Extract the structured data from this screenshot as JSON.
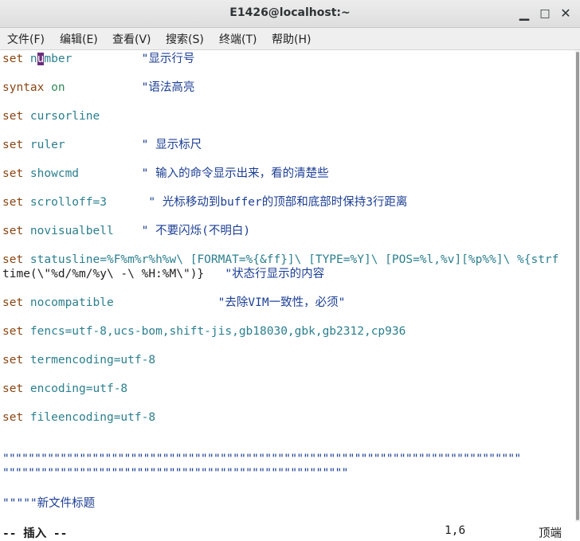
{
  "window": {
    "title": "E1426@localhost:~"
  },
  "menu": [
    "文件(F)",
    "编辑(E)",
    "查看(V)",
    "搜索(S)",
    "终端(T)",
    "帮助(H)"
  ],
  "editor": {
    "lines": [
      {
        "kw": "set",
        "pre": " n",
        "cursor": "u",
        "opt": "mber",
        "pad": "          ",
        "cmt": "\"显示行号"
      },
      {
        "kw": "syntax",
        "on": " on",
        "pad": "           ",
        "cmt": "\"语法高亮"
      },
      {
        "kw": "set",
        "opt": " cursorline"
      },
      {
        "kw": "set",
        "opt": " ruler",
        "pad": "           ",
        "cmt": "\" 显示标尺"
      },
      {
        "kw": "set",
        "opt": " showcmd",
        "pad": "         ",
        "cmt": "\" 输入的命令显示出来，看的清楚些"
      },
      {
        "kw": "set",
        "opt": " scrolloff=3",
        "pad": "      ",
        "cmt": "\" 光标移动到buffer的顶部和底部时保持3行距离"
      },
      {
        "kw": "set",
        "opt": " novisualbell",
        "pad": "    ",
        "cmt": "\" 不要闪烁(不明白)"
      },
      {
        "kw": "set",
        "opt": " statusline=%F%m%r%h%w\\ [FORMAT=%{&ff}]\\ [TYPE=%Y]\\ [POS=%l,%v][%p%%]\\ %{strf"
      },
      {
        "plain": "time(\\\"%d/%m/%y\\ -\\ %H:%M\\\")}",
        "pad": "   ",
        "cmt": "\"状态行显示的内容"
      },
      {
        "kw": "set",
        "opt": " nocompatible",
        "pad": "               ",
        "cmt": "\"去除VIM一致性，必须\""
      },
      {
        "kw": "set",
        "opt": " fencs=utf-8,ucs-bom,shift-jis,gb18030,gbk,gb2312,cp936"
      },
      {
        "kw": "set",
        "opt": " termencoding=utf-8"
      },
      {
        "kw": "set",
        "opt": " encoding=utf-8"
      },
      {
        "kw": "set",
        "opt": " fileencoding=utf-8"
      },
      {
        "quotes": "\"\"\"\"\"\"\"\"\"\"\"\"\"\"\"\"\"\"\"\"\"\"\"\"\"\"\"\"\"\"\"\"\"\"\"\"\"\"\"\"\"\"\"\"\"\"\"\"\"\"\"\"\"\"\"\"\"\"\"\"\"\"\"\"\"\"\"\"\"\"\"\"\"\"\"\"\"\"\"\"\""
      },
      {
        "quotes": "\"\"\"\"\"\"\"\"\"\"\"\"\"\"\"\"\"\"\"\"\"\"\"\"\"\"\"\"\"\"\"\"\"\"\"\"\"\"\"\"\"\"\"\"\"\"\"\"\"\"\"\"\"\""
      },
      {
        "quotes": "\"\"\"\"\"新文件标题"
      }
    ]
  },
  "status": {
    "mode": "-- 插入 --",
    "position": "1,6",
    "scroll": "顶端"
  }
}
